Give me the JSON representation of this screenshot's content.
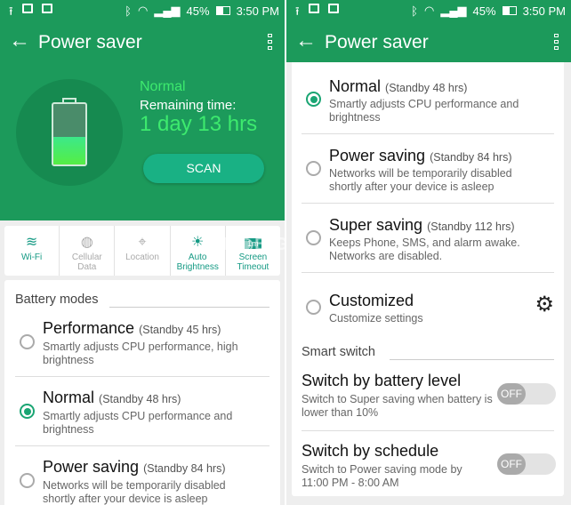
{
  "status": {
    "battery": "45%",
    "time": "3:50 PM"
  },
  "left": {
    "title": "Power saver",
    "hero": {
      "mode": "Normal",
      "remaining_label": "Remaining time:",
      "remaining": "1 day 13 hrs",
      "battery_level_percent": 45,
      "scan": "SCAN"
    },
    "tiles": [
      {
        "label": "Wi-Fi",
        "label2": "",
        "icon": "wifi-icon",
        "on": true
      },
      {
        "label": "Cellular",
        "label2": "Data",
        "icon": "globe-icon",
        "on": false
      },
      {
        "label": "Location",
        "label2": "",
        "icon": "crosshair-icon",
        "on": false
      },
      {
        "label": "Auto",
        "label2": "Brightness",
        "icon": "brightness-icon",
        "on": true
      },
      {
        "label": "Screen",
        "label2": "Timeout",
        "icon": "timer-icon",
        "badge": "1m",
        "on": true
      }
    ],
    "section": "Battery modes",
    "modes": [
      {
        "title": "Performance",
        "standby": "(Standby 45 hrs)",
        "desc": "Smartly adjusts CPU performance, high brightness",
        "selected": false
      },
      {
        "title": "Normal",
        "standby": "(Standby 48 hrs)",
        "desc": "Smartly adjusts CPU performance and brightness",
        "selected": true
      },
      {
        "title": "Power saving",
        "standby": "(Standby 84 hrs)",
        "desc": "Networks will be temporarily disabled shortly after your device is asleep",
        "selected": false
      }
    ]
  },
  "right": {
    "title": "Power saver",
    "modes": [
      {
        "title": "Normal",
        "standby": "(Standby 48 hrs)",
        "desc": "Smartly adjusts CPU performance and brightness",
        "selected": true
      },
      {
        "title": "Power saving",
        "standby": "(Standby 84 hrs)",
        "desc": "Networks will be temporarily disabled shortly after your device is asleep",
        "selected": false
      },
      {
        "title": "Super saving",
        "standby": "(Standby 112 hrs)",
        "desc": "Keeps Phone, SMS, and alarm awake. Networks are disabled.",
        "selected": false
      },
      {
        "title": "Customized",
        "standby": "",
        "desc": "Customize settings",
        "selected": false
      }
    ],
    "section": "Smart switch",
    "switches": [
      {
        "title": "Switch by battery level",
        "desc": "Switch to Super saving when battery is lower than 10%",
        "state": "OFF"
      },
      {
        "title": "Switch by schedule",
        "desc": "Switch to Power saving mode by 11:00 PM - 8:00 AM",
        "state": "OFF"
      }
    ]
  },
  "watermark": "MOBIGYAAN"
}
